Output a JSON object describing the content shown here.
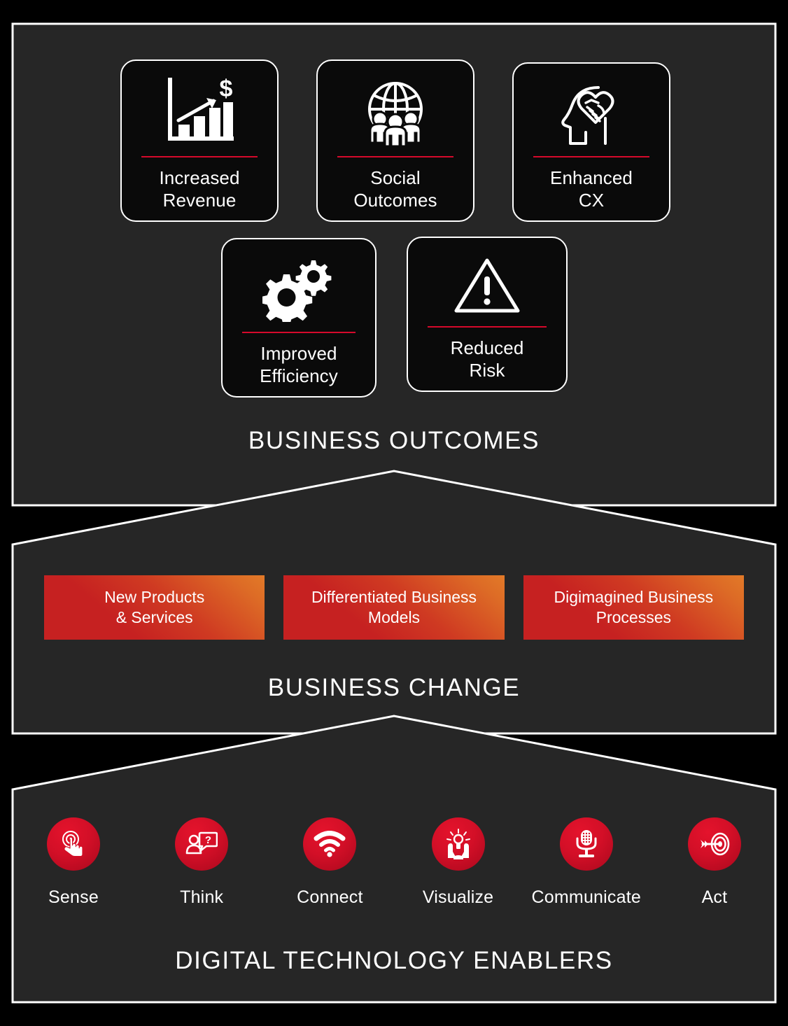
{
  "theme": {
    "page_background": "#000000",
    "panel_background": "#262626",
    "panel_border": "#ffffff",
    "card_background": "#0a0a0a",
    "accent_red": "#d5092b",
    "bar_gradient_from": "#c62121",
    "bar_gradient_to": "#e27a28",
    "badge_red": "#d30f27",
    "text_color": "#ffffff"
  },
  "sections": {
    "outcomes": {
      "title": "BUSINESS OUTCOMES",
      "cards_row1": [
        {
          "label": "Increased\nRevenue",
          "label_line1": "Increased",
          "label_line2": "Revenue",
          "icon": "bar-chart-dollar-icon"
        },
        {
          "label": "Social\nOutcomes",
          "label_line1": "Social",
          "label_line2": "Outcomes",
          "icon": "globe-people-icon"
        },
        {
          "label": "Enhanced\nCX",
          "label_line1": "Enhanced",
          "label_line2": "CX",
          "icon": "head-handshake-icon"
        }
      ],
      "cards_row2": [
        {
          "label": "Improved\nEfficiency",
          "label_line1": "Improved",
          "label_line2": "Efficiency",
          "icon": "gears-icon"
        },
        {
          "label": "Reduced\nRisk",
          "label_line1": "Reduced",
          "label_line2": "Risk",
          "icon": "warning-triangle-icon"
        }
      ]
    },
    "change": {
      "title": "BUSINESS CHANGE",
      "bars": [
        {
          "label_line1": "New Products",
          "label_line2": "& Services"
        },
        {
          "label_line1": "Differentiated Business",
          "label_line2": "Models"
        },
        {
          "label_line1": "Digimagined Business",
          "label_line2": "Processes"
        }
      ]
    },
    "enablers": {
      "title": "DIGITAL TECHNOLOGY ENABLERS",
      "items": [
        {
          "label": "Sense",
          "icon": "touch-fingerprint-icon"
        },
        {
          "label": "Think",
          "icon": "person-question-bubble-icon"
        },
        {
          "label": "Connect",
          "icon": "wifi-icon"
        },
        {
          "label": "Visualize",
          "icon": "hands-lightbulb-icon"
        },
        {
          "label": "Communicate",
          "icon": "microphone-icon"
        },
        {
          "label": "Act",
          "icon": "target-arrow-icon"
        }
      ]
    }
  }
}
